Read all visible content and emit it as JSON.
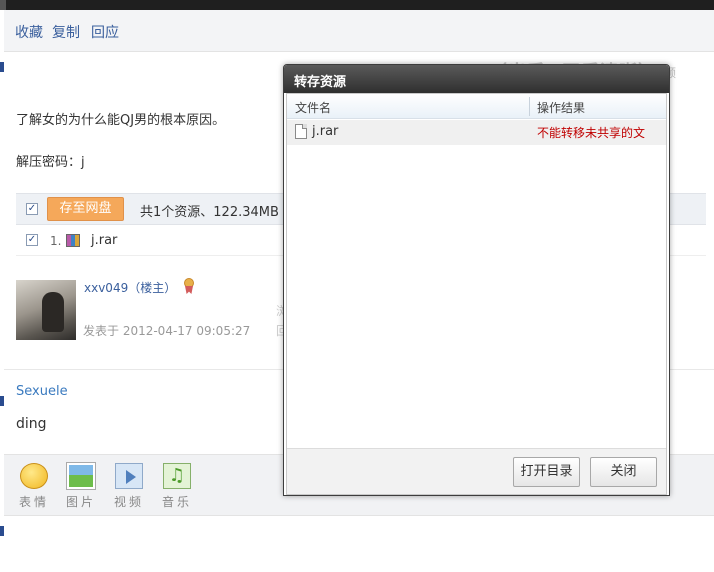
{
  "action_bar": {
    "items": [
      "收藏",
      "复制",
      "回应"
    ]
  },
  "post": {
    "text_line": "了解女的为什么能QJ男的根本原因。",
    "password_line": "解压密码：j"
  },
  "file_share": {
    "save_button": "存至网盘",
    "summary": "共1个资源、122.34MB",
    "files": [
      {
        "index": "1.",
        "name": "j.rar"
      }
    ]
  },
  "author": {
    "name": "xxv049（楼主）",
    "time": "发表于 2012-04-17 09:05:27",
    "frag_1": "浏",
    "frag_2": "回"
  },
  "reply": {
    "user": "Sexuele",
    "text": "ding"
  },
  "toolbar": {
    "items": [
      {
        "label": "表情",
        "icon": "smile-icon"
      },
      {
        "label": "图片",
        "icon": "image-icon"
      },
      {
        "label": "视频",
        "icon": "video-icon"
      },
      {
        "label": "音乐",
        "icon": "music-icon"
      }
    ]
  },
  "overlay": {
    "title": "Sxual Edu（出手+画质清晰）",
    "tail": "频"
  },
  "dialog": {
    "title": "转存资源",
    "col_name": "文件名",
    "col_result": "操作结果",
    "rows": [
      {
        "name": "j.rar",
        "result": "不能转移未共享的文"
      }
    ],
    "open_dir_button": "打开目录",
    "close_button": "关闭"
  },
  "colors": {
    "link": "#3a5f9d",
    "error": "#c00000",
    "save_button": "#f5a85a",
    "dialog_title_bg": "#2f2f2f"
  }
}
